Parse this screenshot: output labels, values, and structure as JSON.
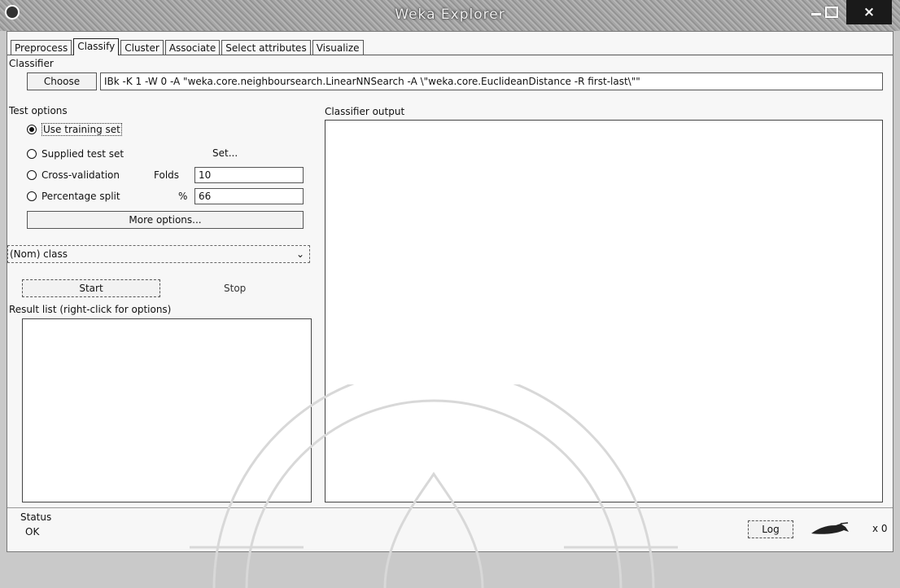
{
  "window": {
    "title": "Weka Explorer",
    "close_glyph": "×"
  },
  "tabs": [
    {
      "label": "Preprocess",
      "active": false
    },
    {
      "label": "Classify",
      "active": true
    },
    {
      "label": "Cluster",
      "active": false
    },
    {
      "label": "Associate",
      "active": false
    },
    {
      "label": "Select attributes",
      "active": false
    },
    {
      "label": "Visualize",
      "active": false
    }
  ],
  "classifier": {
    "section_label": "Classifier",
    "choose_label": "Choose",
    "value": "IBk -K 1 -W 0 -A \"weka.core.neighboursearch.LinearNNSearch -A \\\"weka.core.EuclideanDistance -R first-last\\\"\""
  },
  "test_options": {
    "section_label": "Test options",
    "use_training_set": "Use training set",
    "supplied_test_set": "Supplied test set",
    "set_button": "Set...",
    "cross_validation": "Cross-validation",
    "folds_label": "Folds",
    "folds_value": "10",
    "percentage_split": "Percentage split",
    "percent_label": "%",
    "percent_value": "66",
    "selected": "use_training_set",
    "more_options": "More options..."
  },
  "class_select": {
    "value": "(Nom) class",
    "chevron_glyph": "⌄"
  },
  "actions": {
    "start": "Start",
    "stop": "Stop"
  },
  "result_list": {
    "label": "Result list (right-click for options)"
  },
  "output": {
    "label": "Classifier output"
  },
  "status": {
    "label": "Status",
    "text": "OK",
    "log_button": "Log",
    "task_count": "x 0"
  },
  "icons": {
    "app": "weka-app-icon",
    "status": "weka-bird-icon"
  }
}
